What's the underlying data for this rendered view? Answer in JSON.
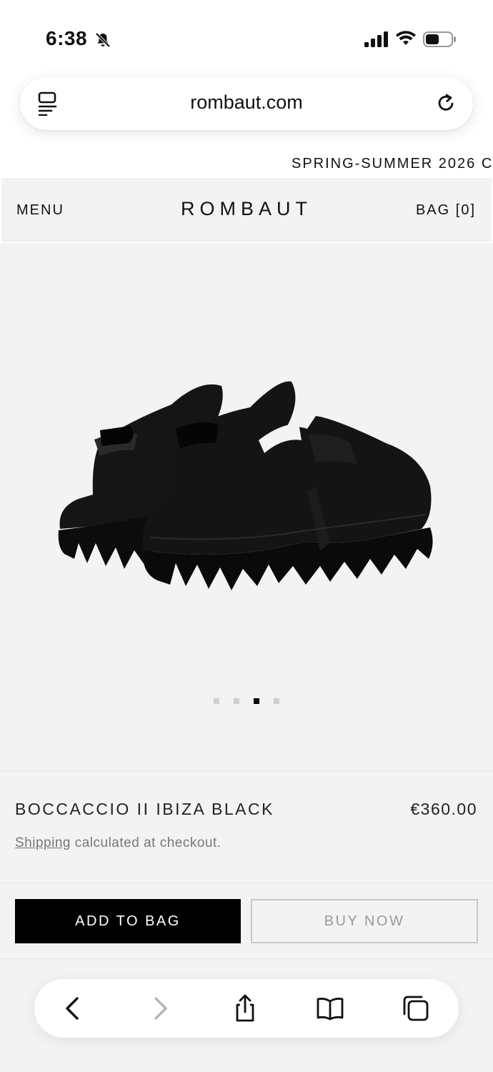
{
  "status_bar": {
    "time": "6:38"
  },
  "browser": {
    "url": "rombaut.com"
  },
  "announcement": {
    "text": "SPRING-SUMMER 2026 C"
  },
  "header": {
    "menu_label": "MENU",
    "logo": "ROMBAUT",
    "bag_label": "BAG [0]"
  },
  "gallery": {
    "slide_count": 4,
    "active_slide": 3
  },
  "product": {
    "name": "BOCCACCIO II IBIZA BLACK",
    "price": "€360.00",
    "shipping_link": "Shipping",
    "shipping_text": " calculated at checkout."
  },
  "actions": {
    "add_to_bag_label": "ADD TO BAG",
    "buy_now_label": "BUY NOW"
  },
  "toolbar": {
    "icons": [
      "back-icon",
      "forward-icon",
      "share-icon",
      "bookmarks-icon",
      "tabs-icon"
    ]
  },
  "colors": {
    "page_bg": "#f3f3f3",
    "primary_button": "#000000",
    "muted_text": "#777777"
  }
}
